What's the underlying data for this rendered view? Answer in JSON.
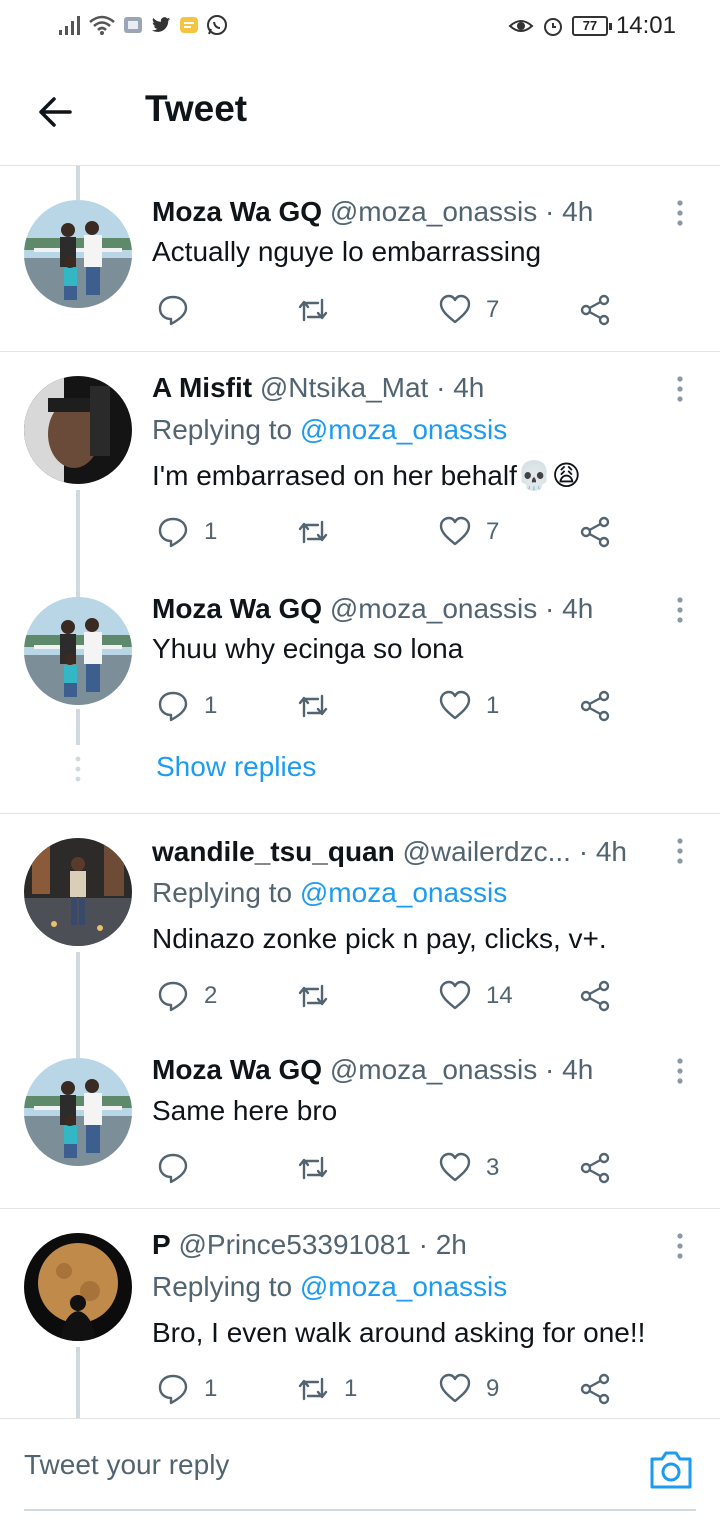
{
  "status_bar": {
    "time": "14:01",
    "battery": "77"
  },
  "header": {
    "title": "Tweet"
  },
  "tweets": [
    {
      "name": "Moza Wa GQ",
      "meta": "@moza_onassis · 4h",
      "replying_prefix": "",
      "replying_to": "",
      "text": "Actually nguye lo embarrassing",
      "replies": "",
      "retweets": "",
      "likes": "7"
    },
    {
      "name": "A Misfit",
      "meta": "@Ntsika_Mat · 4h",
      "replying_prefix": "Replying to ",
      "replying_to": "@moza_onassis",
      "text": "I'm embarrased on her behalf💀😩",
      "replies": "1",
      "retweets": "",
      "likes": "7"
    },
    {
      "name": "Moza Wa GQ",
      "meta": "@moza_onassis · 4h",
      "replying_prefix": "",
      "replying_to": "",
      "text": "Yhuu why ecinga so lona",
      "replies": "1",
      "retweets": "",
      "likes": "1"
    },
    {
      "name": "wandile_tsu_quan",
      "meta": "@wailerdzc... · 4h",
      "replying_prefix": "Replying to ",
      "replying_to": "@moza_onassis",
      "text": "Ndinazo zonke pick n pay, clicks, v+.",
      "replies": "2",
      "retweets": "",
      "likes": "14"
    },
    {
      "name": "Moza Wa GQ",
      "meta": "@moza_onassis · 4h",
      "replying_prefix": "",
      "replying_to": "",
      "text": "Same here bro",
      "replies": "",
      "retweets": "",
      "likes": "3"
    },
    {
      "name": "P",
      "meta": "@Prince53391081 · 2h",
      "replying_prefix": "Replying to ",
      "replying_to": "@moza_onassis",
      "text": "Bro, I even walk around asking for one!!",
      "replies": "1",
      "retweets": "1",
      "likes": "9"
    }
  ],
  "show_replies": "Show replies",
  "reply_bar": {
    "placeholder": "Tweet your reply"
  }
}
